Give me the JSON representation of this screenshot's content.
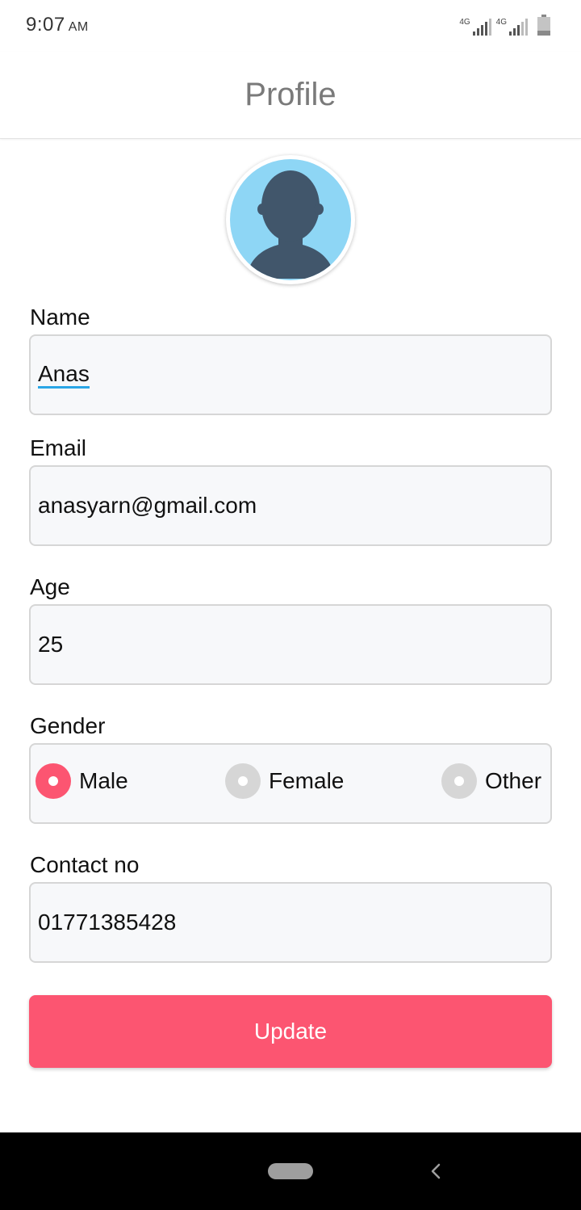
{
  "status_bar": {
    "time": "9:07",
    "ampm": "AM",
    "signal_1_label": "4G",
    "signal_2_label": "4G"
  },
  "header": {
    "title": "Profile"
  },
  "form": {
    "name_label": "Name",
    "name_value": "Anas",
    "email_label": "Email",
    "email_value": "anasyarn@gmail.com",
    "age_label": "Age",
    "age_value": "25",
    "gender_label": "Gender",
    "gender_options": [
      {
        "label": "Male",
        "selected": true
      },
      {
        "label": "Female",
        "selected": false
      },
      {
        "label": "Other",
        "selected": false
      }
    ],
    "contact_label": "Contact no",
    "contact_value": "01771385428",
    "update_label": "Update"
  },
  "colors": {
    "accent": "#fc5571",
    "avatar_bg": "#8ed6f5",
    "avatar_figure": "#41566b",
    "input_underline": "#2aa6e6"
  },
  "icons": [
    "signal-icon",
    "battery-icon",
    "avatar-icon",
    "home-pill-icon",
    "back-icon"
  ]
}
